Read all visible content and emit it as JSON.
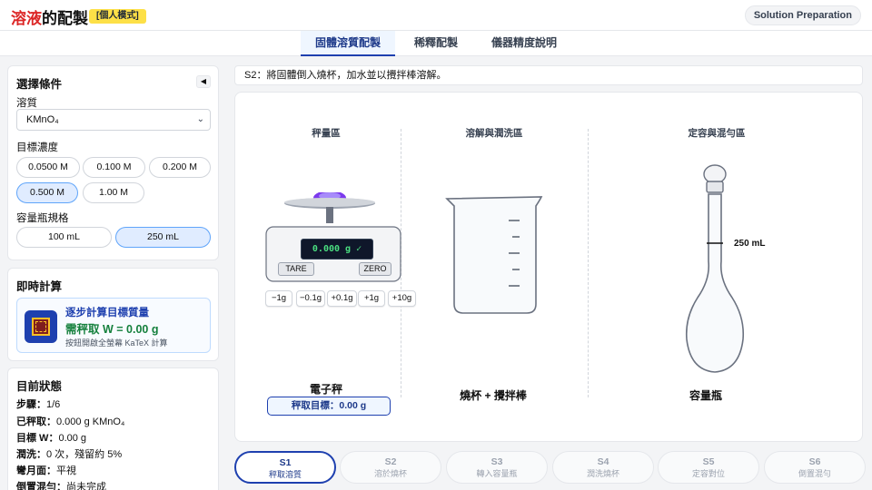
{
  "header": {
    "title_accent": "溶液",
    "title_rest": "的配製",
    "mode_badge": "[個人模式]",
    "lang_pill": "Solution Preparation"
  },
  "tabs": [
    {
      "label": "固體溶質配製",
      "active": true
    },
    {
      "label": "稀釋配製",
      "active": false
    },
    {
      "label": "儀器精度說明",
      "active": false
    }
  ],
  "conditions": {
    "title": "選擇條件",
    "collapse_icon": "◀",
    "solute_label": "溶質",
    "solute_value": "KMnO₄",
    "concentration_label": "目標濃度",
    "concentrations": [
      "0.0500 M",
      "0.100 M",
      "0.200 M",
      "0.500 M",
      "1.00 M"
    ],
    "selected_concentration": "0.500 M",
    "flask_label": "容量瓶規格",
    "flask_sizes": [
      "100 mL",
      "250 mL"
    ],
    "selected_flask": "250 mL"
  },
  "calc": {
    "title": "即時計算",
    "card_title": "逐步計算目標質量",
    "card_value": "需秤取 W = 0.00 g",
    "card_hint": "按鈕開啟全螢幕 KaTeX 計算"
  },
  "status": {
    "title": "目前狀態",
    "rows": [
      {
        "k": "步驟：",
        "v": "1/6"
      },
      {
        "k": "已秤取：",
        "v": "0.000 g KMnO₄"
      },
      {
        "k": "目標 W：",
        "v": "0.00 g"
      },
      {
        "k": "潤洗：",
        "v": "0 次，殘留約 5%"
      },
      {
        "k": "彎月面：",
        "v": "平視"
      },
      {
        "k": "倒置混勻：",
        "v": "尚未完成"
      }
    ]
  },
  "instruction": "S2：將固體倒入燒杯，加水並以攪拌棒溶解。",
  "stage": {
    "zone_weigh": "秤量區",
    "zone_dissolve": "溶解與潤洗區",
    "zone_volume": "定容與混勻區",
    "display": "0.000 g ✓",
    "tare": "TARE",
    "zero": "ZERO",
    "adjust_buttons": [
      "−1g",
      "−0.1g",
      "+0.1g",
      "+1g",
      "+10g"
    ],
    "scale_name": "電子秤",
    "target": "秤取目標：0.00 g",
    "beaker_name": "燒杯 + 攪拌棒",
    "flask_mark": "250 mL",
    "flask_name": "容量瓶"
  },
  "steps": [
    {
      "id": "S1",
      "label": "秤取溶質",
      "active": true
    },
    {
      "id": "S2",
      "label": "溶於燒杯",
      "active": false
    },
    {
      "id": "S3",
      "label": "轉入容量瓶",
      "active": false
    },
    {
      "id": "S4",
      "label": "潤洗燒杯",
      "active": false
    },
    {
      "id": "S5",
      "label": "定容對位",
      "active": false
    },
    {
      "id": "S6",
      "label": "倒置混勻",
      "active": false
    }
  ],
  "colors": {
    "accent": "#1e40af",
    "title_red": "#dc2626",
    "badge": "#fde047",
    "success": "#15803d",
    "powder": "#7c3aed"
  }
}
